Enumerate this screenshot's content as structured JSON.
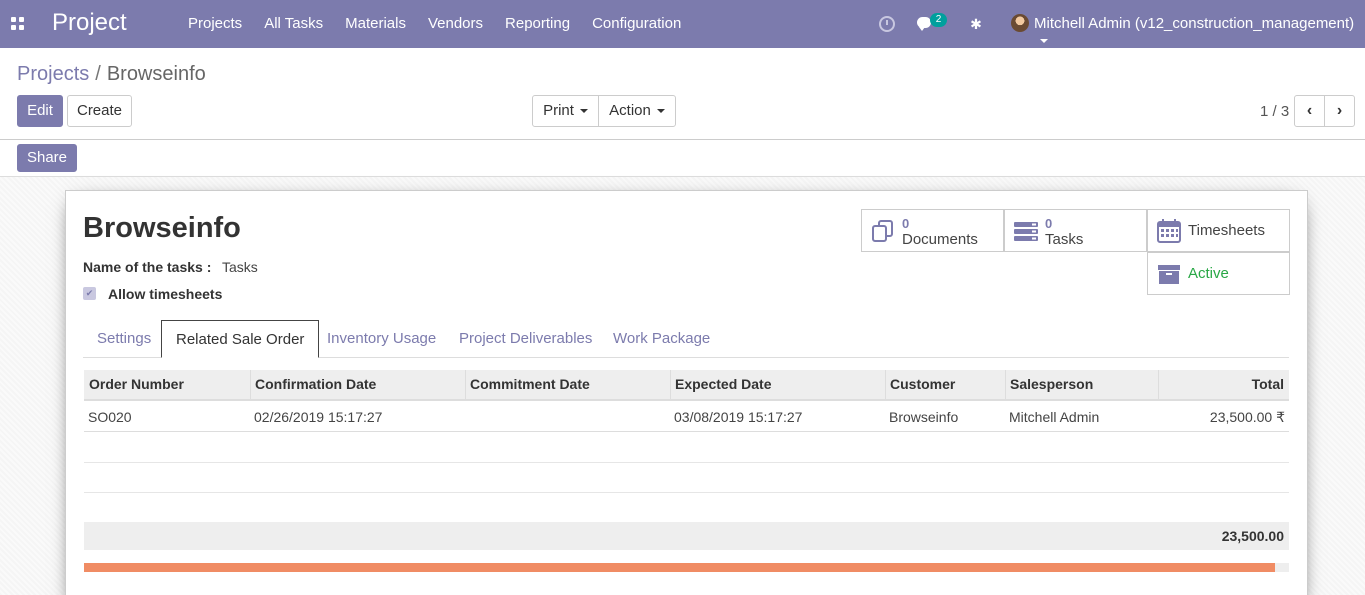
{
  "app": {
    "brand": "Project",
    "menu": [
      "Projects",
      "All Tasks",
      "Materials",
      "Vendors",
      "Reporting",
      "Configuration"
    ],
    "chat_count": "2",
    "user": "Mitchell Admin (v12_construction_management)"
  },
  "control_panel": {
    "breadcrumb_parent": "Projects",
    "breadcrumb_sep": "/",
    "breadcrumb_current": "Browseinfo",
    "edit_label": "Edit",
    "create_label": "Create",
    "print_label": "Print",
    "action_label": "Action",
    "pager": "1 / 3"
  },
  "share_label": "Share",
  "record": {
    "title": "Browseinfo",
    "name_of_tasks_label": "Name of the tasks :",
    "name_of_tasks_value": "Tasks",
    "allow_timesheets_label": "Allow timesheets",
    "allow_timesheets_checked": true
  },
  "smart_buttons": {
    "documents": {
      "count": "0",
      "label": "Documents"
    },
    "tasks": {
      "count": "0",
      "label": "Tasks"
    },
    "timesheets": {
      "label": "Timesheets"
    },
    "active": {
      "label": "Active",
      "color": "#28a745"
    }
  },
  "tabs": [
    "Settings",
    "Related Sale Order",
    "Inventory Usage",
    "Project Deliverables",
    "Work Package"
  ],
  "active_tab": "Related Sale Order",
  "table": {
    "headers": [
      "Order Number",
      "Confirmation Date",
      "Commitment Date",
      "Expected Date",
      "Customer",
      "Salesperson",
      "Total"
    ],
    "rows": [
      [
        "SO020",
        "02/26/2019 15:17:27",
        "",
        "03/08/2019 15:17:27",
        "Browseinfo",
        "Mitchell Admin",
        "23,500.00 ₹"
      ]
    ],
    "footer_total": "23,500.00"
  },
  "progress": {
    "fraction": 0.988,
    "color": "#f08c64"
  },
  "colors": {
    "primary": "#7c7bad",
    "accent": "#00a09d"
  }
}
